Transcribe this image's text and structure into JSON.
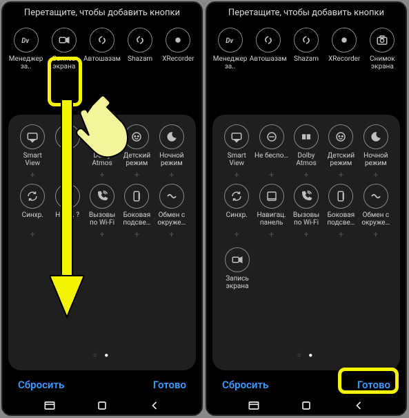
{
  "hint": "Перетащите, чтобы добавить кнопки",
  "footer": {
    "reset": "Сбросить",
    "done": "Готово"
  },
  "left": {
    "top": [
      {
        "name": "app-dv",
        "label": "Менеджер за..",
        "icon": "dv"
      },
      {
        "name": "screen-record",
        "label": "Запись экрана",
        "icon": "rec"
      },
      {
        "name": "auto-shazam",
        "label": "Автошазам",
        "icon": "shazam"
      },
      {
        "name": "shazam",
        "label": "Shazam",
        "icon": "shazam"
      },
      {
        "name": "xrecorder",
        "label": "XRecorder",
        "icon": "dot"
      }
    ],
    "panel1": [
      {
        "name": "smart-view",
        "label": "Smart View",
        "icon": "cast"
      },
      {
        "name": "dnd",
        "label": "б…",
        "icon": "minus"
      },
      {
        "name": "dolby-atmos",
        "label": "Dolby Atmos",
        "icon": "dolby"
      },
      {
        "name": "kids-mode",
        "label": "Детский режим",
        "icon": "kid"
      },
      {
        "name": "night-mode",
        "label": "Ночной режим",
        "icon": "moon"
      }
    ],
    "panel2": [
      {
        "name": "sync",
        "label": "Синхр.",
        "icon": "sync"
      },
      {
        "name": "nav-panel",
        "label": "Н…ац. ?",
        "icon": "nav"
      },
      {
        "name": "wifi-calling",
        "label": "Вызовы по Wi-Fi",
        "icon": "wificall"
      },
      {
        "name": "side-light",
        "label": "Боковая подсве…",
        "icon": "side"
      },
      {
        "name": "nearby-share",
        "label": "Обмен с окруже…",
        "icon": "share"
      }
    ]
  },
  "right": {
    "top": [
      {
        "name": "app-dv",
        "label": "Менеджер за..",
        "icon": "dv"
      },
      {
        "name": "auto-shazam",
        "label": "Автошазам",
        "icon": "shazam"
      },
      {
        "name": "shazam",
        "label": "Shazam",
        "icon": "shazam"
      },
      {
        "name": "xrecorder",
        "label": "XRecorder",
        "icon": "dot"
      },
      {
        "name": "screenshot",
        "label": "Снимок экрана",
        "icon": "camera"
      }
    ],
    "panel1": [
      {
        "name": "smart-view",
        "label": "Smart View",
        "icon": "cast"
      },
      {
        "name": "dnd",
        "label": "Не беспо…",
        "icon": "minus"
      },
      {
        "name": "dolby-atmos",
        "label": "Dolby Atmos",
        "icon": "dolby"
      },
      {
        "name": "kids-mode",
        "label": "Детский режим",
        "icon": "kid"
      },
      {
        "name": "night-mode",
        "label": "Ночной режим",
        "icon": "moon"
      }
    ],
    "panel2": [
      {
        "name": "sync",
        "label": "Синхр.",
        "icon": "sync"
      },
      {
        "name": "nav-panel",
        "label": "Навигац. панель",
        "icon": "nav"
      },
      {
        "name": "wifi-calling",
        "label": "Вызовы по Wi-Fi",
        "icon": "wificall"
      },
      {
        "name": "side-light",
        "label": "Боковая подсве…",
        "icon": "side"
      },
      {
        "name": "nearby-share",
        "label": "Обмен с окруже…",
        "icon": "share"
      }
    ],
    "extra": {
      "name": "screen-record",
      "label": "Запись экрана",
      "icon": "rec"
    }
  },
  "colors": {
    "accent": "#3a9bff",
    "highlight": "#f4f400"
  }
}
